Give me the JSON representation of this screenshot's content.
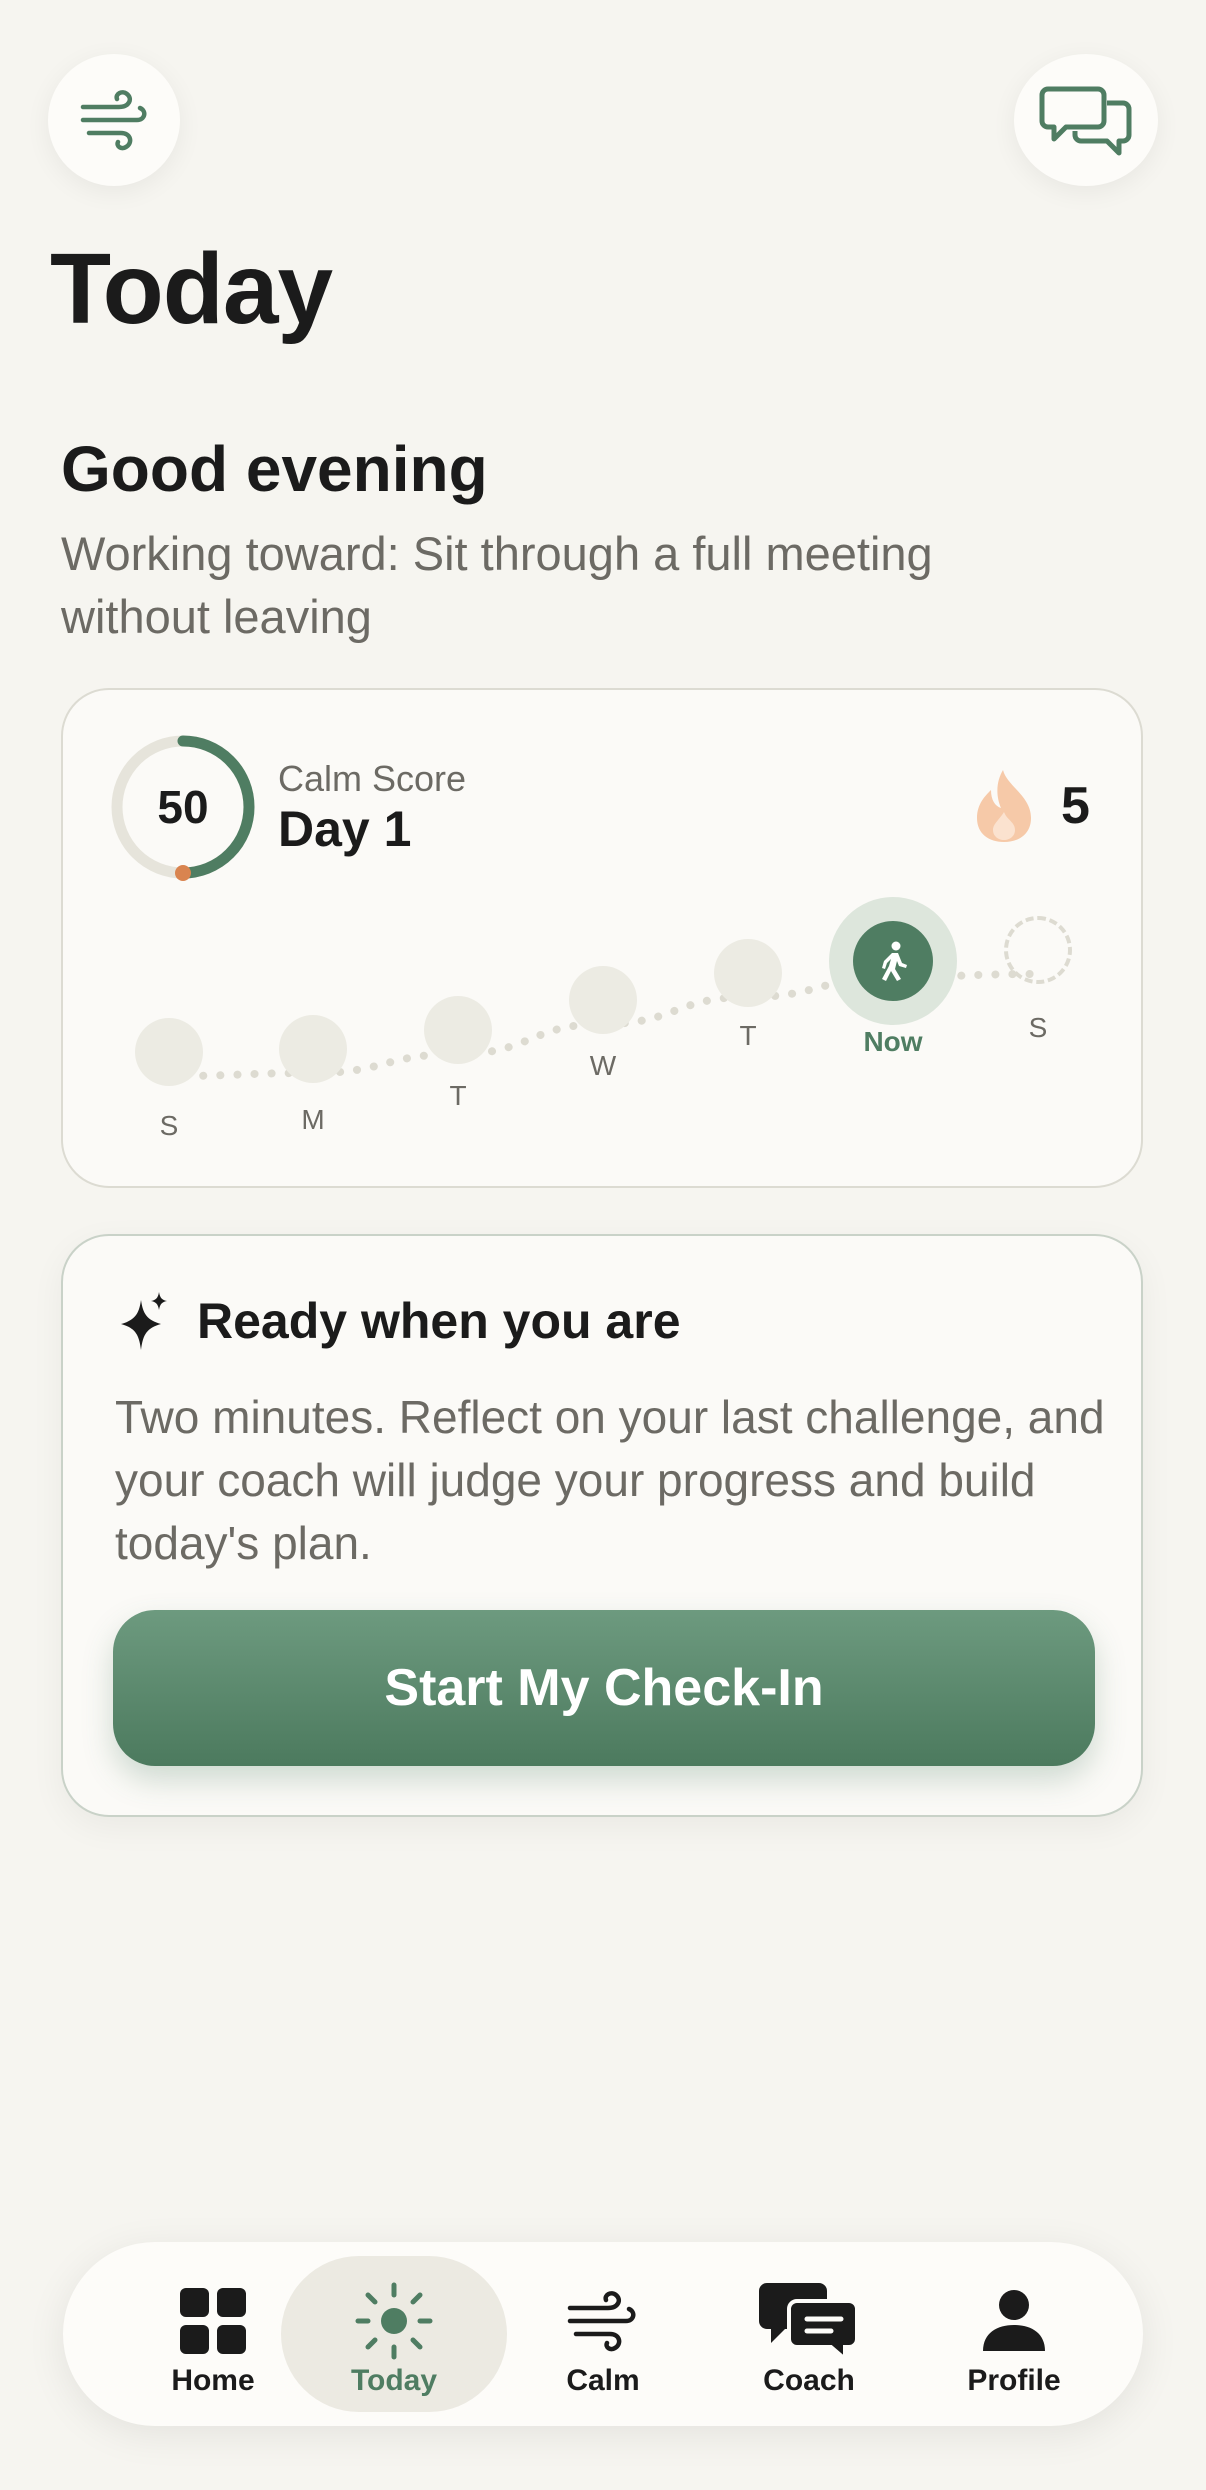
{
  "header": {
    "breath_icon": "wind-icon",
    "chat_icon": "chat-bubbles-icon",
    "title": "Today"
  },
  "greeting": {
    "title": "Good evening",
    "goal": "Working toward: Sit through a full meeting without leaving"
  },
  "score_card": {
    "score": "50",
    "score_progress": 0.5,
    "label": "Calm Score",
    "day": "Day 1",
    "streak": "5",
    "streak_icon": "flame-icon",
    "week": [
      {
        "letter": "S"
      },
      {
        "letter": "M"
      },
      {
        "letter": "T"
      },
      {
        "letter": "W"
      },
      {
        "letter": "T"
      },
      {
        "letter": "Now",
        "current": true
      },
      {
        "letter": "S",
        "future": true
      }
    ]
  },
  "checkin_card": {
    "title": "Ready when you are",
    "body": "Two minutes. Reflect on your last challenge, and your coach will judge your progress and build today's plan.",
    "button": "Start My Check-In"
  },
  "tabbar": {
    "tabs": [
      {
        "label": "Home",
        "icon": "grid-icon"
      },
      {
        "label": "Today",
        "icon": "sun-icon",
        "active": true
      },
      {
        "label": "Calm",
        "icon": "wind-icon"
      },
      {
        "label": "Coach",
        "icon": "chat-icon"
      },
      {
        "label": "Profile",
        "icon": "person-icon"
      }
    ]
  },
  "colors": {
    "accent": "#4f7d62",
    "background": "#f6f5f0",
    "flame": "#f6c9a8",
    "ring_track": "#e6e4db"
  }
}
